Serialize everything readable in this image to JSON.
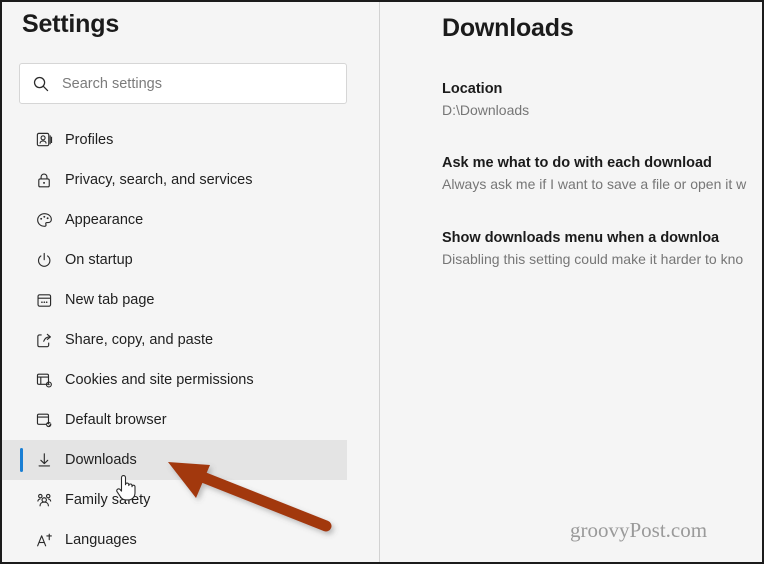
{
  "window": {
    "title": "Settings"
  },
  "search": {
    "placeholder": "Search settings",
    "value": "",
    "icon": "search-icon"
  },
  "sidebar": {
    "items": [
      {
        "label": "Profiles",
        "icon": "profile-card-icon",
        "selected": false
      },
      {
        "label": "Privacy, search, and services",
        "icon": "lock-icon",
        "selected": false
      },
      {
        "label": "Appearance",
        "icon": "paint-palette-icon",
        "selected": false
      },
      {
        "label": "On startup",
        "icon": "power-icon",
        "selected": false
      },
      {
        "label": "New tab page",
        "icon": "new-tab-icon",
        "selected": false
      },
      {
        "label": "Share, copy, and paste",
        "icon": "share-icon",
        "selected": false
      },
      {
        "label": "Cookies and site permissions",
        "icon": "window-gear-icon",
        "selected": false
      },
      {
        "label": "Default browser",
        "icon": "window-check-icon",
        "selected": false
      },
      {
        "label": "Downloads",
        "icon": "download-arrow-icon",
        "selected": true
      },
      {
        "label": "Family safety",
        "icon": "people-group-icon",
        "selected": false
      },
      {
        "label": "Languages",
        "icon": "language-a-icon",
        "selected": false
      }
    ]
  },
  "panel": {
    "title": "Downloads",
    "settings": [
      {
        "title": "Location",
        "description": "D:\\Downloads"
      },
      {
        "title": "Ask me what to do with each download",
        "description": "Always ask me if I want to save a file or open it w"
      },
      {
        "title": "Show downloads menu when a downloa",
        "description": "Disabling this setting could make it harder to kno"
      }
    ]
  },
  "watermark": {
    "text": "groovyPost.com"
  },
  "annotation": {
    "arrow_color": "#a2380f",
    "accent_color": "#1a7fd4",
    "cursor": "pointer-hand-cursor"
  }
}
